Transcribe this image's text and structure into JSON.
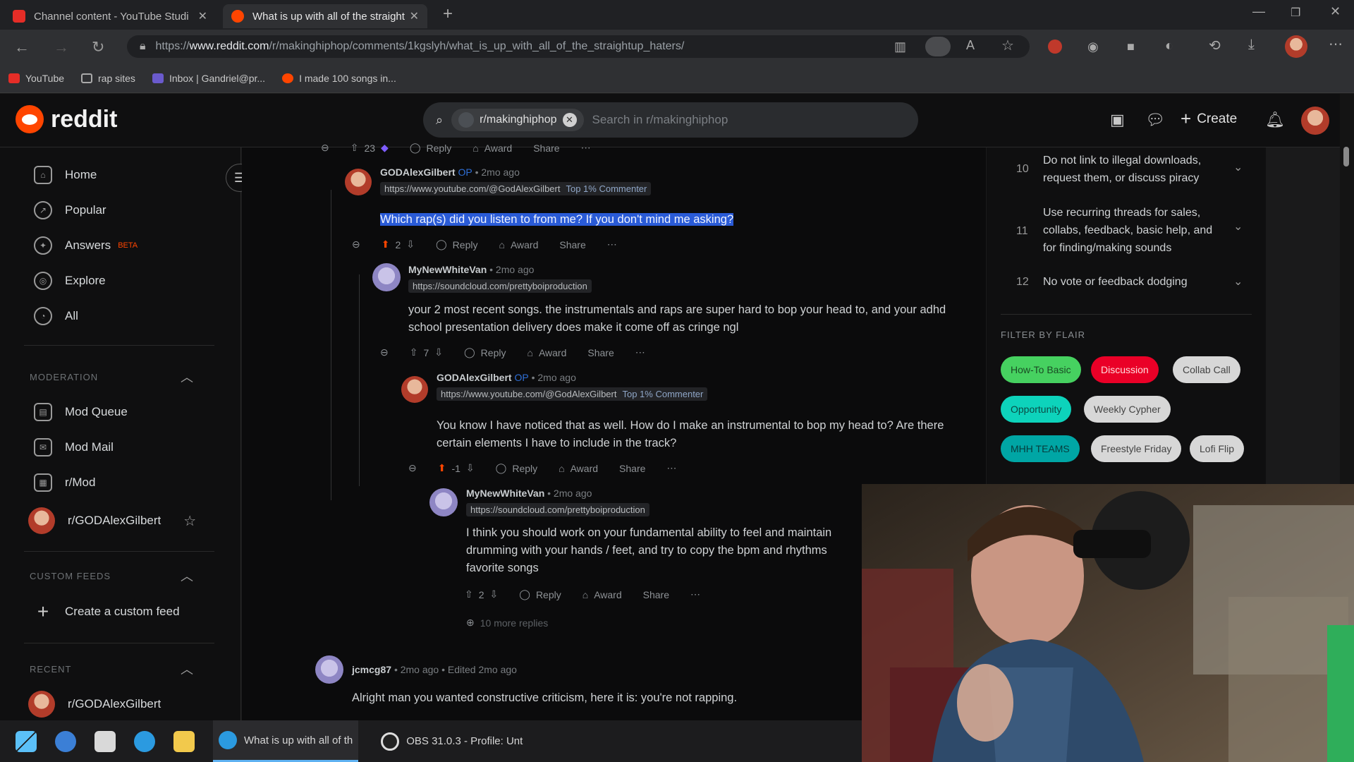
{
  "browser": {
    "tabs": [
      {
        "title": "Channel content - YouTube Studi",
        "active": false
      },
      {
        "title": "What is up with all of the straight",
        "active": true
      }
    ],
    "url_prefix": "https://",
    "url_domain": "www.reddit.com",
    "url_path": "/r/makinghiphop/comments/1kgslyh/what_is_up_with_all_of_the_straightup_haters/",
    "bookmarks": [
      "YouTube",
      "rap sites",
      "Inbox | Gandriel@pr...",
      "I made 100 songs in..."
    ]
  },
  "reddit": {
    "brand": "reddit",
    "search_chip": "r/makinghiphop",
    "search_placeholder": "Search in r/makinghiphop",
    "create_label": "Create"
  },
  "sidebar": {
    "nav": [
      {
        "label": "Home",
        "icon": "home-icon"
      },
      {
        "label": "Popular",
        "icon": "popular-icon"
      },
      {
        "label": "Answers",
        "icon": "answers-icon",
        "badge": "BETA"
      },
      {
        "label": "Explore",
        "icon": "explore-icon"
      },
      {
        "label": "All",
        "icon": "all-icon"
      }
    ],
    "moderation_title": "MODERATION",
    "moderation": [
      "Mod Queue",
      "Mod Mail",
      "r/Mod",
      "r/GODAlexGilbert"
    ],
    "custom_feeds_title": "CUSTOM FEEDS",
    "create_feed": "Create a custom feed",
    "recent_title": "RECENT",
    "recent": [
      "r/GODAlexGilbert"
    ]
  },
  "comments": {
    "top_actions": {
      "votes": "23",
      "reply": "Reply",
      "award": "Award",
      "share": "Share"
    },
    "c1": {
      "author": "GODAlexGilbert",
      "op": "OP",
      "time": "• 2mo ago",
      "flair_link": "https://www.youtube.com/@GodAlexGilbert",
      "flair_badge": "Top 1% Commenter",
      "body": "Which rap(s) did you listen to from me? If you don't mind me asking?",
      "votes": "2"
    },
    "c2": {
      "author": "MyNewWhiteVan",
      "time": "• 2mo ago",
      "flair_link": "https://soundcloud.com/prettyboiproduction",
      "body": "your 2 most recent songs. the instrumentals and raps are super hard to bop your head to, and your adhd school presentation delivery does make it come off as cringe ngl",
      "votes": "7"
    },
    "c3": {
      "author": "GODAlexGilbert",
      "op": "OP",
      "time": "• 2mo ago",
      "flair_link": "https://www.youtube.com/@GodAlexGilbert",
      "flair_badge": "Top 1% Commenter",
      "body": "You know I have noticed that as well. How do I make an instrumental to bop my head to? Are there certain elements I have to include in the track?",
      "votes": "-1"
    },
    "c4": {
      "author": "MyNewWhiteVan",
      "time": "• 2mo ago",
      "flair_link": "https://soundcloud.com/prettyboiproduction",
      "body": "I think you should work on your fundamental ability to feel and maintain drumming with your hands / feet, and try to copy the bpm and rhythms favorite songs",
      "votes": "2",
      "more": "10 more replies"
    },
    "c5": {
      "author": "jcmcg87",
      "time": "• 2mo ago • Edited 2mo ago",
      "body": "Alright man you wanted constructive criticism, here it is: you're not rapping."
    },
    "reply": "Reply",
    "award": "Award",
    "share": "Share"
  },
  "right_sidebar": {
    "rules": [
      {
        "num": "10",
        "text": "Do not link to illegal downloads, request them, or discuss piracy"
      },
      {
        "num": "11",
        "text": "Use recurring threads for sales, collabs, feedback, basic help, and for finding/making sounds"
      },
      {
        "num": "12",
        "text": "No vote or feedback dodging"
      }
    ],
    "filter_title": "FILTER BY FLAIR",
    "flairs": [
      {
        "label": "How-To Basic",
        "bg": "#46d160",
        "fg": "#1a4a24"
      },
      {
        "label": "Discussion",
        "bg": "#ea0027",
        "fg": "#ffdede"
      },
      {
        "label": "Collab Call",
        "bg": "#d7d7d7",
        "fg": "#444444"
      },
      {
        "label": "Opportunity",
        "bg": "#0dd3bb",
        "fg": "#0b4a44"
      },
      {
        "label": "Weekly Cypher",
        "bg": "#d7d7d7",
        "fg": "#444444"
      },
      {
        "label": "MHH TEAMS",
        "bg": "#00a6a5",
        "fg": "#063c3c"
      },
      {
        "label": "Freestyle Friday",
        "bg": "#d7d7d7",
        "fg": "#444444"
      },
      {
        "label": "Lofi Flip",
        "bg": "#d7d7d7",
        "fg": "#444444"
      }
    ]
  },
  "taskbar": {
    "apps": [
      "What is up with all of th",
      "OBS 31.0.3 - Profile: Unt"
    ]
  },
  "colors": {
    "accent": "#ff4500",
    "upvote_active": "#ff4500",
    "link": "#2a5bd7"
  }
}
